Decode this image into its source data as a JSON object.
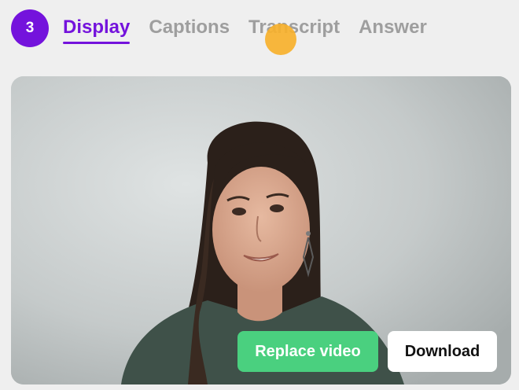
{
  "step": {
    "number": "3"
  },
  "tabs": [
    {
      "label": "Display",
      "active": true
    },
    {
      "label": "Captions",
      "active": false
    },
    {
      "label": "Transcript",
      "active": false
    },
    {
      "label": "Answer",
      "active": false
    }
  ],
  "video": {
    "content": "presenter-video-frame"
  },
  "actions": {
    "replace_label": "Replace video",
    "download_label": "Download"
  },
  "colors": {
    "accent": "#7413dc",
    "inactive_tab": "#9e9e9e",
    "replace_button": "#4ad07f",
    "download_button": "#ffffff",
    "cursor": "#f7b12c",
    "background": "#efefef"
  }
}
